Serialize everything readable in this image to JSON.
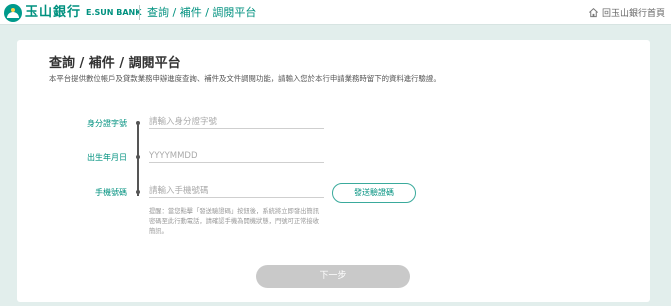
{
  "header": {
    "brand_cn": "玉山銀行",
    "brand_en": "E.SUN BANK",
    "title": "查詢 / 補件 / 調閱平台",
    "home_link": "回玉山銀行首頁"
  },
  "main": {
    "title": "查詢 / 補件 / 調閱平台",
    "description": "本平台提供數位帳戶及貸款業務申辦進度查詢、補件及文件調閱功能，請輸入您於本行申請業務時留下的資料進行驗證。"
  },
  "form": {
    "id_label": "身分證字號",
    "id_placeholder": "請輸入身分證字號",
    "birth_label": "出生年月日",
    "birth_placeholder": "YYYYMMDD",
    "phone_label": "手機號碼",
    "phone_placeholder": "請輸入手機號碼",
    "send_otp_label": "發送驗證碼",
    "hint": "提醒：當您點擊「發送驗證碼」按鈕後，系統將立即發出簡訊密碼至此行動電話，請確認手機為開機狀態，門號可正常接收簡訊。",
    "next_label": "下一步"
  },
  "colors": {
    "brand": "#00917f",
    "background": "#e2eeec",
    "disabled_button": "#c9c9c9"
  },
  "icons": [
    "home-icon"
  ]
}
